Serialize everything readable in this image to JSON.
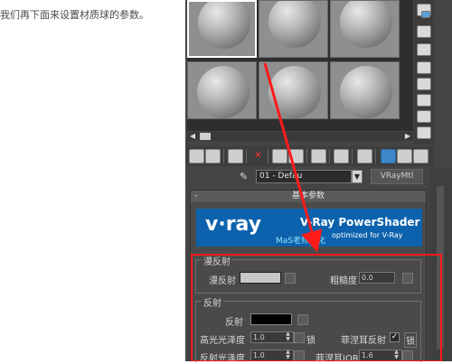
{
  "tutorial": {
    "text": "我们再下面来设置材质球的参数。"
  },
  "toolbar": {
    "delete_glyph": "✕"
  },
  "material": {
    "name": "01 - Defau",
    "dropdown_glyph": "▼",
    "type_label": "VRayMtl"
  },
  "rollout": {
    "collapse_glyph": "-",
    "title": "基本参数"
  },
  "banner": {
    "logo": "v·ray",
    "title": "V-Ray PowerShader",
    "subtitle": "optimized for V-Ray",
    "credit": "MaS老师汉化"
  },
  "diffuse_group": {
    "title": "漫反射",
    "diffuse_label": "漫反射",
    "diffuse_color": "#c7c7c7",
    "roughness_label": "粗糙度",
    "roughness_value": "0.0"
  },
  "reflection_group": {
    "title": "反射",
    "reflect_label": "反射",
    "reflect_color": "#000000",
    "hilight_gloss_label": "高光光泽度",
    "hilight_gloss_value": "1.0",
    "lock_label": "锁",
    "fresnel_label": "菲涅耳反射",
    "fresnel_checked": "✓",
    "fresnel_lock_label": "锁",
    "refl_gloss_label": "反射光泽度",
    "refl_gloss_value": "1.0",
    "fresnel_ior_label": "菲涅耳IOR",
    "fresnel_ior_value": "1.6"
  },
  "scroll": {
    "left_arrow": "◀",
    "right_arrow": "▶"
  },
  "colors": {
    "annotation": "#ff1a1a",
    "panel_bg": "#444444",
    "banner_bg": "#0d62ad"
  },
  "icons": [
    "eyedropper-icon",
    "delete-icon",
    "sphere-preview-icon",
    "checker-icon",
    "backlight-icon"
  ]
}
